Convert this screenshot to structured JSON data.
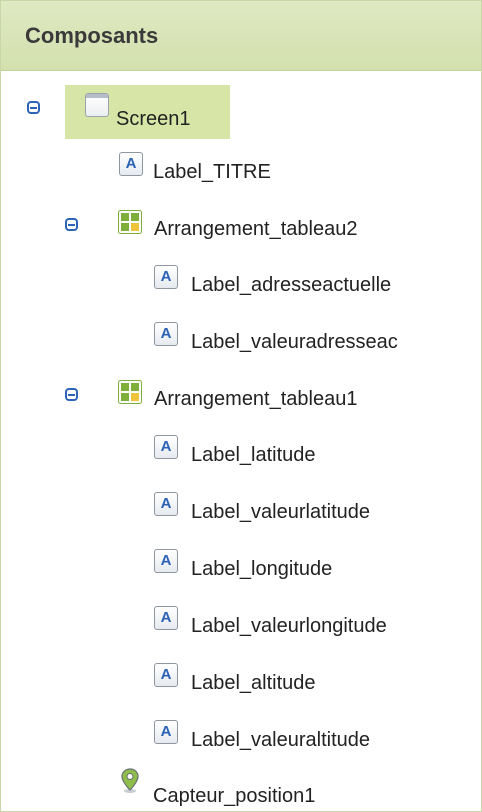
{
  "panel": {
    "title": "Composants"
  },
  "tree": {
    "screen": "Screen1",
    "label_titre": "Label_TITRE",
    "arr2": {
      "name": "Arrangement_tableau2",
      "children": [
        "Label_adresseactuelle",
        "Label_valeuradresseac"
      ]
    },
    "arr1": {
      "name": "Arrangement_tableau1",
      "children": [
        "Label_latitude",
        "Label_valeurlatitude",
        "Label_longitude",
        "Label_valeurlongitude",
        "Label_altitude",
        "Label_valeuraltitude"
      ]
    },
    "sensor": "Capteur_position1"
  },
  "icons": {
    "label": "A",
    "colors": {
      "accent": "#2d64b8",
      "header": "#d3e0ad",
      "selection": "#d7e6a6",
      "grid_green": "#7fae3a"
    }
  }
}
